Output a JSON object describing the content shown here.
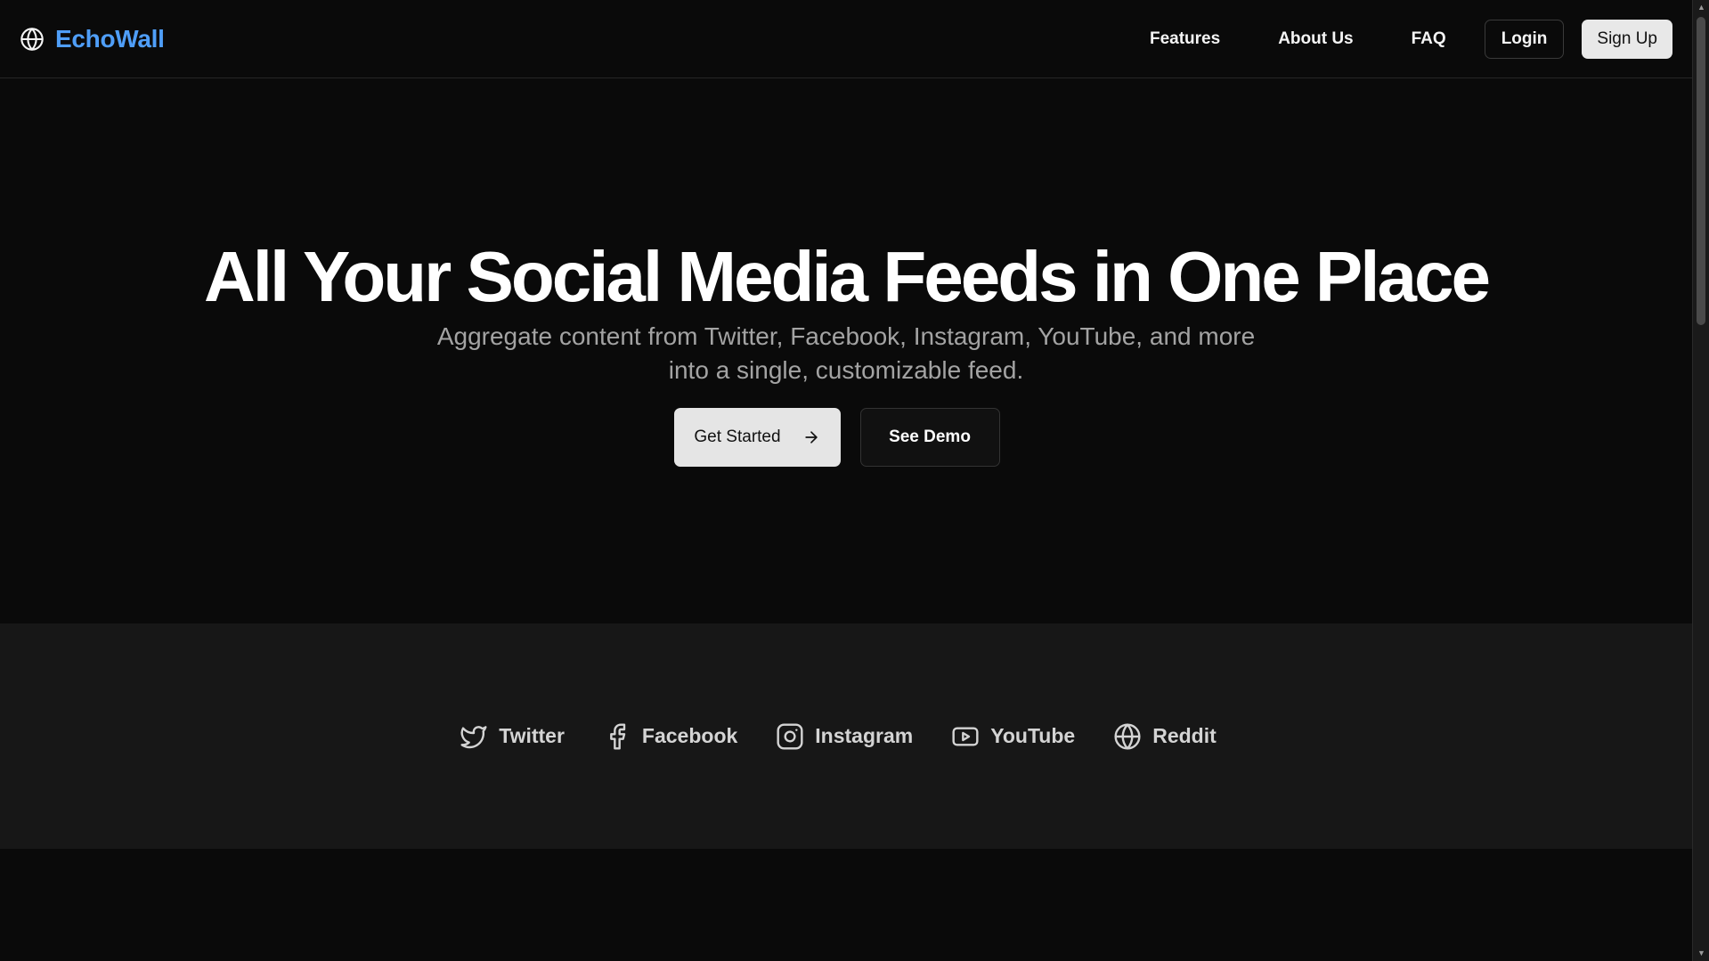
{
  "header": {
    "brand_name": "EchoWall",
    "brand_icon": "globe-icon",
    "nav": [
      "Features",
      "About Us",
      "FAQ"
    ],
    "login_label": "Login",
    "signup_label": "Sign Up"
  },
  "hero": {
    "title": "All Your Social Media Feeds in One Place",
    "subtitle": "Aggregate content from Twitter, Facebook, Instagram, YouTube, and more into a single, customizable feed.",
    "primary_cta": "Get Started",
    "primary_cta_icon": "arrow-right-icon",
    "secondary_cta": "See Demo"
  },
  "platforms": [
    {
      "label": "Twitter",
      "icon": "twitter-icon"
    },
    {
      "label": "Facebook",
      "icon": "facebook-icon"
    },
    {
      "label": "Instagram",
      "icon": "instagram-icon"
    },
    {
      "label": "YouTube",
      "icon": "youtube-icon"
    },
    {
      "label": "Reddit",
      "icon": "globe-icon"
    }
  ],
  "colors": {
    "background": "#0a0a0a",
    "band": "#171717",
    "brand_accent": "#4f9ef8",
    "primary_button": "#e5e5e5"
  }
}
